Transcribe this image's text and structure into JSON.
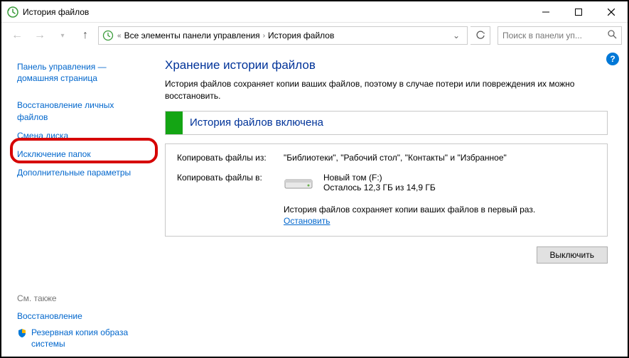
{
  "window": {
    "title": "История файлов"
  },
  "toolbar": {
    "breadcrumb_prefix": "«",
    "breadcrumb_parent": "Все элементы панели управления",
    "breadcrumb_current": "История файлов",
    "search_placeholder": "Поиск в панели уп..."
  },
  "sidebar": {
    "home": "Панель управления — домашняя страница",
    "restore": "Восстановление личных файлов",
    "change_drive": "Смена диска",
    "exclude": "Исключение папок",
    "advanced": "Дополнительные параметры",
    "see_also": "См. также",
    "restore_system": "Восстановление",
    "image_backup": "Резервная копия образа системы"
  },
  "main": {
    "title": "Хранение истории файлов",
    "description": "История файлов сохраняет копии ваших файлов, поэтому в случае потери или повреждения их можно восстановить.",
    "status": "История файлов включена",
    "copy_from_label": "Копировать файлы из:",
    "copy_from_value": "\"Библиотеки\", \"Рабочий стол\", \"Контакты\" и \"Избранное\"",
    "copy_to_label": "Копировать файлы в:",
    "drive_name": "Новый том (F:)",
    "drive_free": "Осталось 12,3 ГБ из 14,9 ГБ",
    "progress_msg": "История файлов сохраняет копии ваших файлов в первый раз.",
    "stop": "Остановить",
    "turn_off": "Выключить"
  }
}
